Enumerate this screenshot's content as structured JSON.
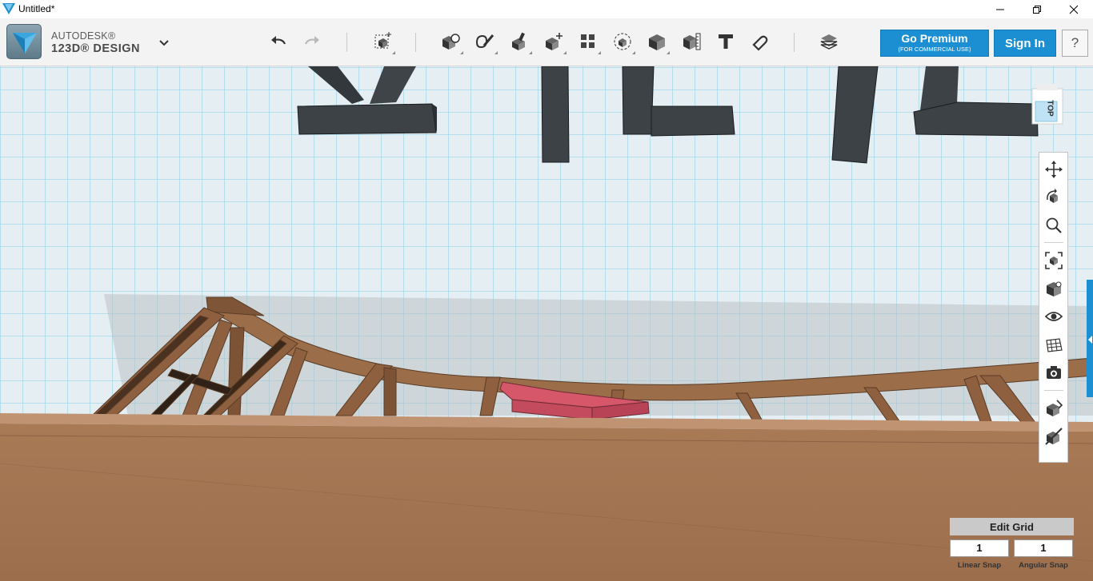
{
  "window": {
    "title": "Untitled*",
    "controls": [
      "minimize",
      "maximize",
      "close"
    ]
  },
  "brand": {
    "line1": "AUTODESK®",
    "line2": "123D® DESIGN"
  },
  "toolbar": {
    "tools": [
      {
        "name": "undo-icon"
      },
      {
        "name": "redo-icon",
        "disabled": true
      },
      {
        "name": "transform-icon"
      },
      {
        "name": "primitives-icon"
      },
      {
        "name": "sketch-icon"
      },
      {
        "name": "construct-icon"
      },
      {
        "name": "modify-icon"
      },
      {
        "name": "pattern-icon"
      },
      {
        "name": "group-icon"
      },
      {
        "name": "combine-icon"
      },
      {
        "name": "measure-icon"
      },
      {
        "name": "text-icon"
      },
      {
        "name": "snap-icon"
      },
      {
        "name": "material-icon"
      }
    ],
    "premium_label": "Go Premium",
    "premium_sub": "(FOR COMMERCIAL USE)",
    "signin_label": "Sign In",
    "help_label": "?"
  },
  "viewcube": {
    "face": "TOP"
  },
  "navbar": {
    "tools": [
      "pan-icon",
      "orbit-icon",
      "zoom-icon",
      "fit-icon",
      "view-cube-icon",
      "visibility-icon",
      "grid-icon",
      "screenshot-icon",
      "materials-outlines-icon",
      "hide-icon"
    ]
  },
  "grid": {
    "edit_label": "Edit Grid",
    "linear_snap_value": "1",
    "angular_snap_value": "1",
    "linear_snap_label": "Linear Snap",
    "angular_snap_label": "Angular Snap"
  },
  "colors": {
    "accent": "#1b8fd2",
    "grid_bg": "#e6eef2",
    "grid_line": "#7fcbe8",
    "wood": "#a87752",
    "dark_solid": "#3d4246",
    "selected_part": "#d9596b"
  }
}
